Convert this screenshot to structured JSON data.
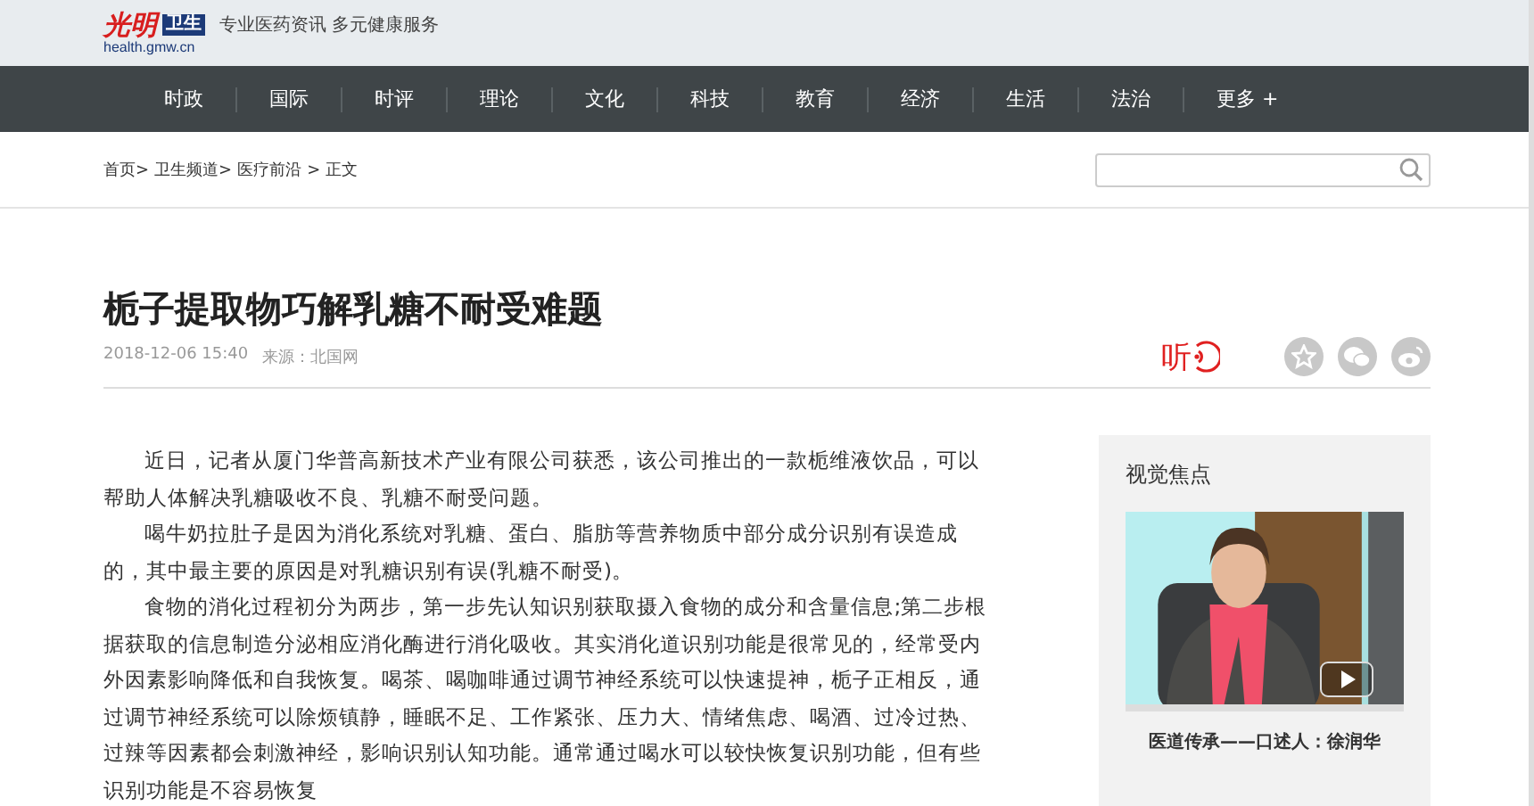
{
  "header": {
    "logo_text": "光明",
    "logo_badge": "卫生",
    "logo_url": "health.gmw.cn",
    "slogan": "专业医药资讯 多元健康服务"
  },
  "nav": {
    "items": [
      {
        "label": "时政"
      },
      {
        "label": "国际"
      },
      {
        "label": "时评"
      },
      {
        "label": "理论"
      },
      {
        "label": "文化"
      },
      {
        "label": "科技"
      },
      {
        "label": "教育"
      },
      {
        "label": "经济"
      },
      {
        "label": "生活"
      },
      {
        "label": "法治"
      },
      {
        "label": "更多 +"
      }
    ]
  },
  "breadcrumb": [
    "首页>",
    "卫生频道>",
    "医疗前沿",
    "> 正文"
  ],
  "article": {
    "title": "栀子提取物巧解乳糖不耐受难题",
    "date": "2018-12-06 15:40",
    "source": "来源：北国网",
    "listen": "听",
    "paragraphs": [
      "近日，记者从厦门华普高新技术产业有限公司获悉，该公司推出的一款栀维液饮品，可以帮助人体解决乳糖吸收不良、乳糖不耐受问题。",
      "喝牛奶拉肚子是因为消化系统对乳糖、蛋白、脂肪等营养物质中部分成分识别有误造成的，其中最主要的原因是对乳糖识别有误(乳糖不耐受)。",
      "食物的消化过程初分为两步，第一步先认知识别获取摄入食物的成分和含量信息;第二步根据获取的信息制造分泌相应消化酶进行消化吸收。其实消化道识别功能是很常见的，经常受内外因素影响降低和自我恢复。喝茶、喝咖啡通过调节神经系统可以快速提神，栀子正相反，通过调节神经系统可以除烦镇静，睡眠不足、工作紧张、压力大、情绪焦虑、喝酒、过冷过热、过辣等因素都会刺激神经，影响识别认知功能。通常通过喝水可以较快恢复识别功能，但有些识别功能是不容易恢复"
    ]
  },
  "sidebar": {
    "title": "视觉焦点",
    "video": {
      "kind": "picture",
      "caption": "医道传承——口述人：徐润华"
    }
  }
}
